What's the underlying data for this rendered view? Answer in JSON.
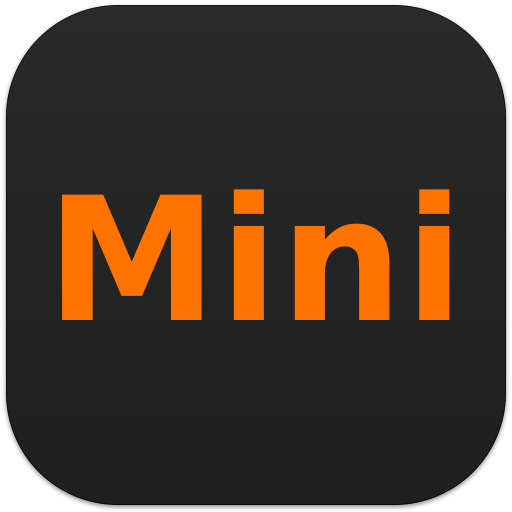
{
  "icon": {
    "label": "Mini",
    "text_color": "#ff7300",
    "background_color": "#252525"
  }
}
